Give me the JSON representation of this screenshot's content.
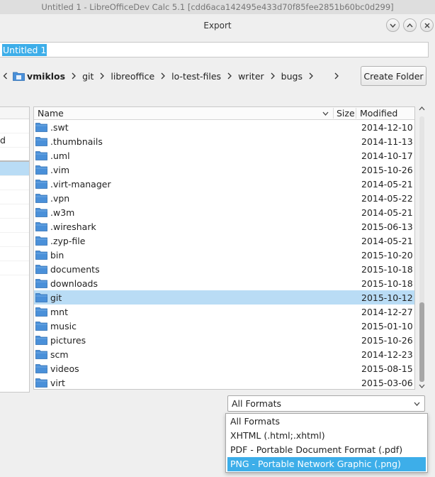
{
  "window": {
    "title": "Untitled 1 - LibreOfficeDev Calc 5.1 [cdd6aca142495e433d70f85fee2851b60bc0d299]"
  },
  "dialog": {
    "title": "Export"
  },
  "filename": {
    "value": "Untitled 1"
  },
  "breadcrumb": {
    "home": "vmiklos",
    "items": [
      "git",
      "libreoffice",
      "lo-test-files",
      "writer",
      "bugs"
    ]
  },
  "create_folder_label": "Create Folder",
  "places": {
    "visible_text": "d"
  },
  "columns": {
    "name": "Name",
    "size": "Size",
    "modified": "Modified"
  },
  "files": [
    {
      "name": ".swt",
      "modified": "2014-12-10"
    },
    {
      "name": ".thumbnails",
      "modified": "2014-11-13"
    },
    {
      "name": ".uml",
      "modified": "2014-10-17"
    },
    {
      "name": ".vim",
      "modified": "2015-10-26"
    },
    {
      "name": ".virt-manager",
      "modified": "2014-05-21"
    },
    {
      "name": ".vpn",
      "modified": "2014-05-22"
    },
    {
      "name": ".w3m",
      "modified": "2014-05-21"
    },
    {
      "name": ".wireshark",
      "modified": "2015-06-13"
    },
    {
      "name": ".zyp-file",
      "modified": "2014-05-21"
    },
    {
      "name": "bin",
      "modified": "2015-10-20"
    },
    {
      "name": "documents",
      "modified": "2015-10-18"
    },
    {
      "name": "downloads",
      "modified": "2015-10-18"
    },
    {
      "name": "git",
      "modified": "2015-10-12",
      "selected": true
    },
    {
      "name": "mnt",
      "modified": "2014-12-27"
    },
    {
      "name": "music",
      "modified": "2015-01-10"
    },
    {
      "name": "pictures",
      "modified": "2015-10-26"
    },
    {
      "name": "scm",
      "modified": "2014-12-23"
    },
    {
      "name": "videos",
      "modified": "2015-08-15"
    },
    {
      "name": "virt",
      "modified": "2015-03-06"
    }
  ],
  "filter": {
    "selected": "All Formats",
    "options": [
      "All Formats",
      "XHTML (.html;.xhtml)",
      "PDF - Portable Document Format (.pdf)",
      "PNG - Portable Network Graphic (.png)"
    ],
    "highlighted_index": 3
  },
  "colors": {
    "accent": "#3daee9",
    "selection": "#b9dcf5",
    "folder": "#4a90d9"
  }
}
